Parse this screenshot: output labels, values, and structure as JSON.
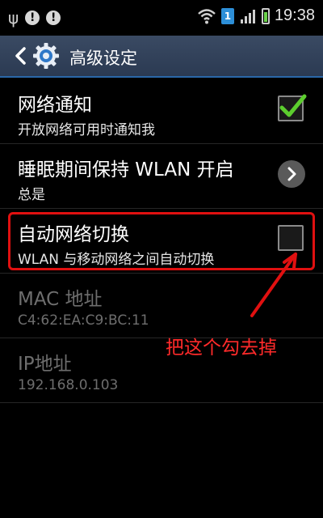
{
  "status_bar": {
    "time": "19:38",
    "sim_label": "1",
    "left_glyphs": [
      "ψ",
      "!",
      "!"
    ]
  },
  "header": {
    "title": "高级设定"
  },
  "list": [
    {
      "title": "网络通知",
      "subtitle": "开放网络可用时通知我",
      "control": "checkbox-checked",
      "enabled": true
    },
    {
      "title": "睡眠期间保持 WLAN 开启",
      "subtitle": "总是",
      "control": "chevron",
      "enabled": true
    },
    {
      "title": "自动网络切换",
      "subtitle": "WLAN 与移动网络之间自动切换",
      "control": "checkbox-unchecked",
      "enabled": true
    },
    {
      "title": "MAC 地址",
      "subtitle": "C4:62:EA:C9:BC:11",
      "control": "none",
      "enabled": false
    },
    {
      "title": "IP地址",
      "subtitle": "192.168.0.103",
      "control": "none",
      "enabled": false
    }
  ],
  "annotation": {
    "text": "把这个勾去掉",
    "color": "#e01010"
  },
  "colors": {
    "accent": "#2a67a8",
    "check": "#5ccd2e",
    "actionbar": "#34445c"
  }
}
